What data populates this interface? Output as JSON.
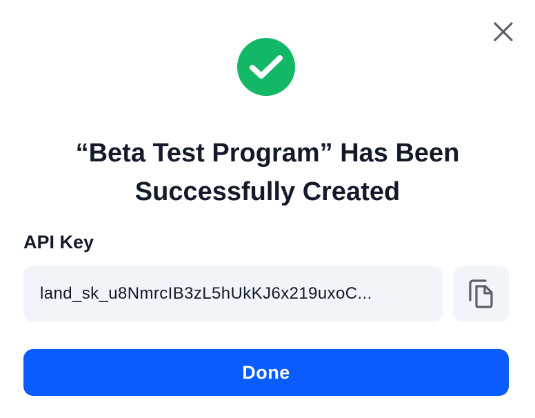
{
  "dialog": {
    "title": "“Beta Test Program” Has Been Successfully Created",
    "close_icon": "close-icon",
    "success_icon": "check-icon",
    "api_key_label": "API Key",
    "api_key_value": "land_sk_u8NmrcIB3zL5hUkKJ6x219uxoC...",
    "copy_icon": "copy-icon",
    "done_label": "Done"
  },
  "colors": {
    "primary": "#0a5cff",
    "success": "#13b866",
    "field_background": "#f1f4f8",
    "text": "#131a2a"
  }
}
